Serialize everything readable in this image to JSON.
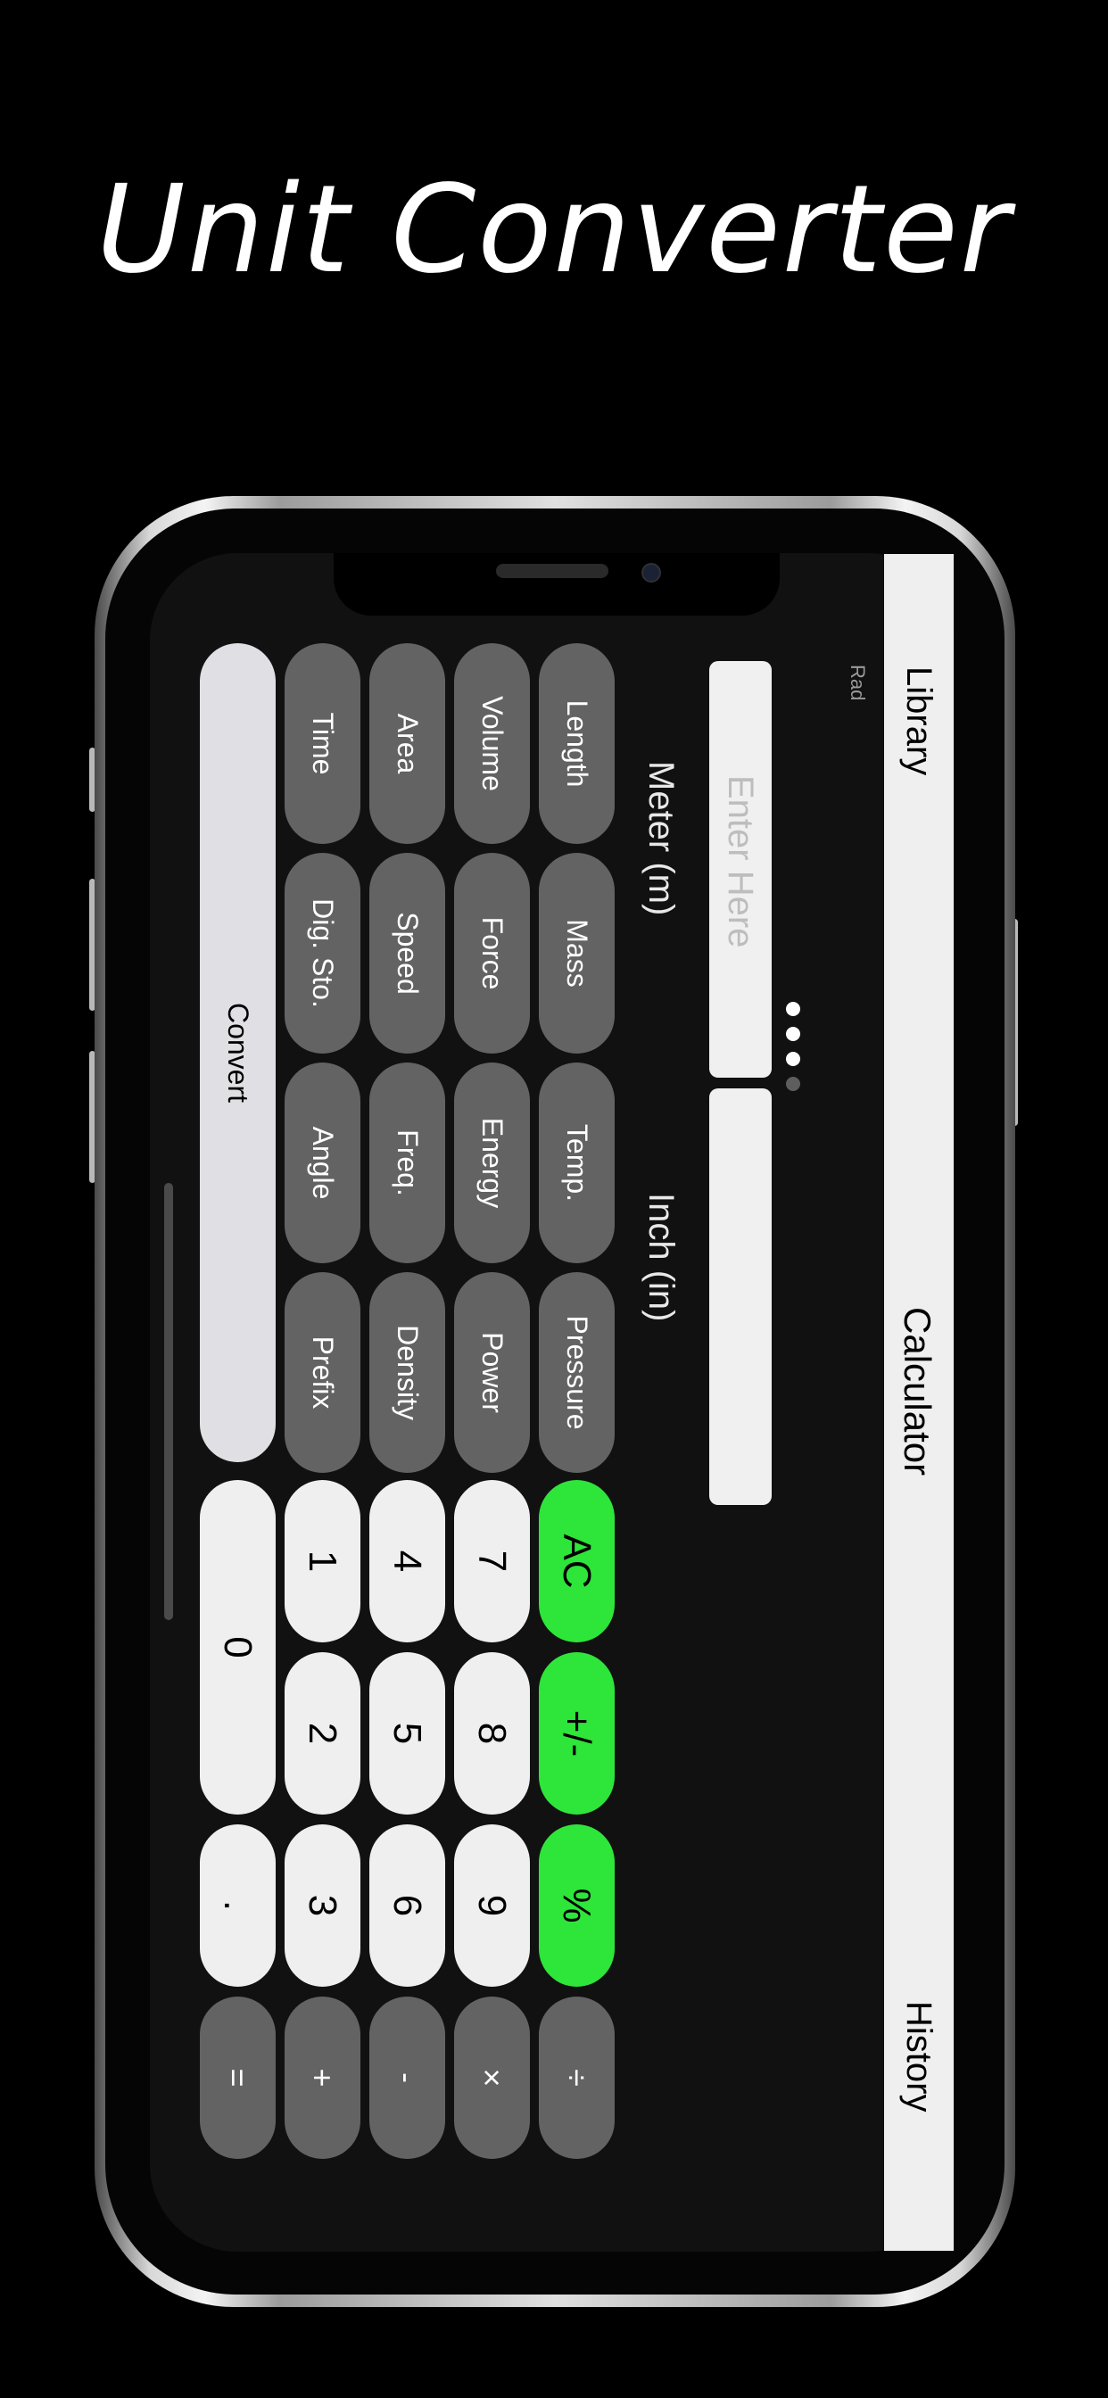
{
  "promo": {
    "title": "Unit Converter"
  },
  "nav": {
    "left": "Library",
    "center": "Calculator",
    "right": "History",
    "mode": "Rad"
  },
  "converter": {
    "input_placeholder": "Enter Here",
    "output_value": "",
    "from_unit": "Meter (m)",
    "to_unit": "Inch (in)",
    "page_dots_count": 4,
    "active_page_dot": 4,
    "categories": [
      [
        "Length",
        "Mass",
        "Temp.",
        "Pressure"
      ],
      [
        "Volume",
        "Force",
        "Energy",
        "Power"
      ],
      [
        "Area",
        "Speed",
        "Freq.",
        "Density"
      ],
      [
        "Time",
        "Dig. Sto.",
        "Angle",
        "Prefix"
      ]
    ],
    "convert_label": "Convert"
  },
  "keypad": {
    "ac": "AC",
    "sign": "+/-",
    "percent": "%",
    "divide": "÷",
    "seven": "7",
    "eight": "8",
    "nine": "9",
    "multiply": "×",
    "four": "4",
    "five": "5",
    "six": "6",
    "minus": "-",
    "one": "1",
    "two": "2",
    "three": "3",
    "plus": "+",
    "zero": "0",
    "decimal": ".",
    "equals": "="
  },
  "colors": {
    "accent_green": "#2ee53a",
    "pill_gray": "#636363",
    "key_light": "#efefef",
    "background": "#000000"
  }
}
